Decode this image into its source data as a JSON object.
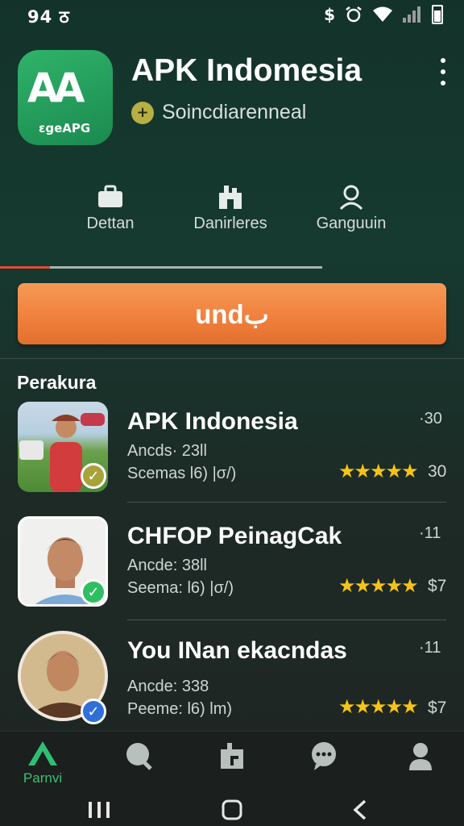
{
  "status_bar": {
    "time": "94 ठ",
    "icons": [
      "dollar-icon",
      "alarm-icon",
      "wifi-icon",
      "signal-icon",
      "battery-icon"
    ],
    "dollar": "$"
  },
  "header": {
    "app_title": "APK Indomesia",
    "logo_text": "AA",
    "logo_subtext": "ɛgeAPG",
    "developer_icon_glyph": "+",
    "developer": "Soincdiarenneal"
  },
  "actions": [
    {
      "label": "Dettan",
      "icon": "briefcase-icon"
    },
    {
      "label": "Danirleres",
      "icon": "building-icon"
    },
    {
      "label": "Ganguuin",
      "icon": "person-icon"
    }
  ],
  "update_button": {
    "label": "undب"
  },
  "progress": {
    "value": 0.155
  },
  "section": {
    "title": "Perakura"
  },
  "items": [
    {
      "title": "APK Indonesia",
      "line1": "Ancds· 23ll",
      "line2": "Scemas l6)  |σ/)",
      "corner": "·30",
      "score": "30",
      "rating": "★★★★★",
      "check_color": "#a8a23a"
    },
    {
      "title": "CHFOP PeinagCak",
      "line1": "Ancde: 38ll",
      "line2": "Seema: l6)  |σ/)",
      "corner": "·11",
      "score": "$7",
      "rating": "★★★★★",
      "check_color": "#2fbf62"
    },
    {
      "title": "You INan ekacndas",
      "line1": "Ancde: 338",
      "line2": "Peeme: l6)  lm)",
      "corner": "·11",
      "score": "$7",
      "rating": "★★★★★",
      "check_color": "#2f6fd8"
    }
  ],
  "bottom_nav": {
    "items": [
      {
        "label": "Parnvi",
        "icon": "home-logo-icon"
      },
      {
        "label": "",
        "icon": "search-icon"
      },
      {
        "label": "",
        "icon": "library-icon"
      },
      {
        "label": "",
        "icon": "chat-icon"
      },
      {
        "label": "",
        "icon": "profile-icon"
      }
    ]
  },
  "system_nav": [
    "recents-icon",
    "home-icon",
    "back-icon"
  ]
}
